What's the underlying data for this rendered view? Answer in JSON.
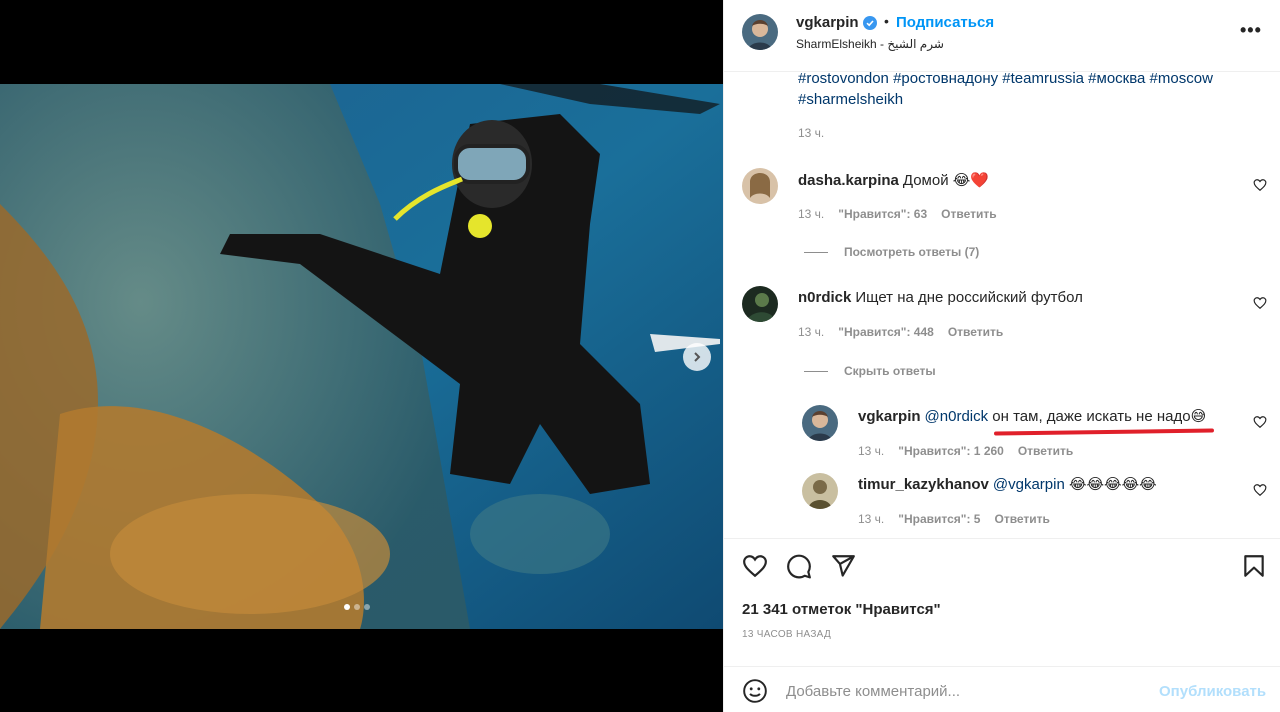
{
  "post": {
    "username": "vgkarpin",
    "follow_label": "Подписаться",
    "bullet": "•",
    "location": "SharmElsheikh - شرم الشيخ",
    "more_label": "•••",
    "hashtags": [
      "#rostovondon",
      "#ростовнадону",
      "#teamrussia",
      "#москва",
      "#moscow",
      "#sharmelsheikh"
    ],
    "caption_time": "13 ч."
  },
  "comments": [
    {
      "username": "dasha.karpina",
      "text": "Домой 😂❤️",
      "time": "13 ч.",
      "likes": "\"Нравится\": 63",
      "reply_label": "Ответить",
      "replies_toggle": "Посмотреть ответы (7)"
    },
    {
      "username": "n0rdick",
      "text": "Ищет на дне российский футбол",
      "time": "13 ч.",
      "likes": "\"Нравится\": 448",
      "reply_label": "Ответить",
      "replies_toggle": "Скрыть ответы"
    }
  ],
  "replies": [
    {
      "username": "vgkarpin",
      "mention": "@n0rdick",
      "text": "он там, даже искать не надо😅",
      "time": "13 ч.",
      "likes": "\"Нравится\": 1 260",
      "reply_label": "Ответить"
    },
    {
      "username": "timur_kazykhanov",
      "mention": "@vgkarpin",
      "text": "😂😂😂😂😂",
      "time": "13 ч.",
      "likes": "\"Нравится\": 5",
      "reply_label": "Ответить"
    }
  ],
  "footer": {
    "likes_text": "21 341 отметок \"Нравится\"",
    "time_ago": "13 ЧАСОВ НАЗАД",
    "comment_placeholder": "Добавьте комментарий...",
    "publish_label": "Опубликовать"
  },
  "carousel": {
    "slide_count": 3,
    "active_index": 0
  },
  "colors": {
    "link": "#00376b",
    "accent": "#0095f6",
    "publish_disabled": "#b2dffc",
    "underline": "#e0202a",
    "muted": "#8e8e8e"
  }
}
